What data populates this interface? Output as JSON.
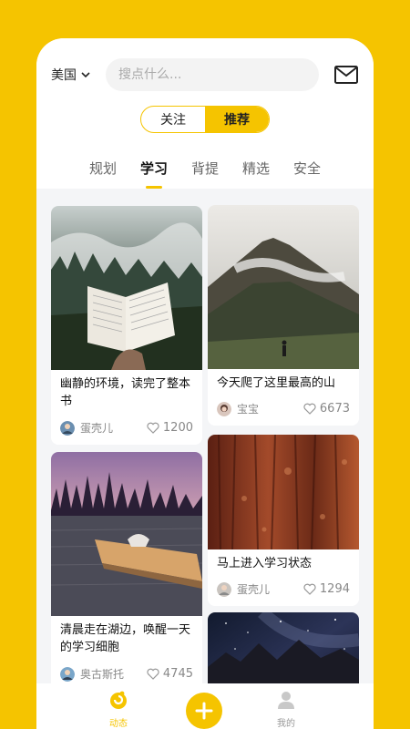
{
  "header": {
    "region_label": "美国",
    "search_placeholder": "搜点什么...",
    "segment": [
      "关注",
      "推荐"
    ],
    "tabs": [
      "规划",
      "学习",
      "背提",
      "精选",
      "安全"
    ]
  },
  "cards": [
    {
      "title": "幽静的环境，读完了整本书",
      "author": "蛋壳儿",
      "likes": "1200"
    },
    {
      "title": "今天爬了这里最高的山",
      "author": "宝宝",
      "likes": "6673"
    },
    {
      "title": "清晨走在湖边，唤醒一天的学习细胞",
      "author": "奥古斯托",
      "likes": "4745"
    },
    {
      "title": "马上进入学习状态",
      "author": "蛋壳儿",
      "likes": "1294"
    }
  ],
  "bottom_nav": {
    "feed_label": "动态",
    "mine_label": "我的"
  },
  "colors": {
    "accent": "#f5c400"
  }
}
